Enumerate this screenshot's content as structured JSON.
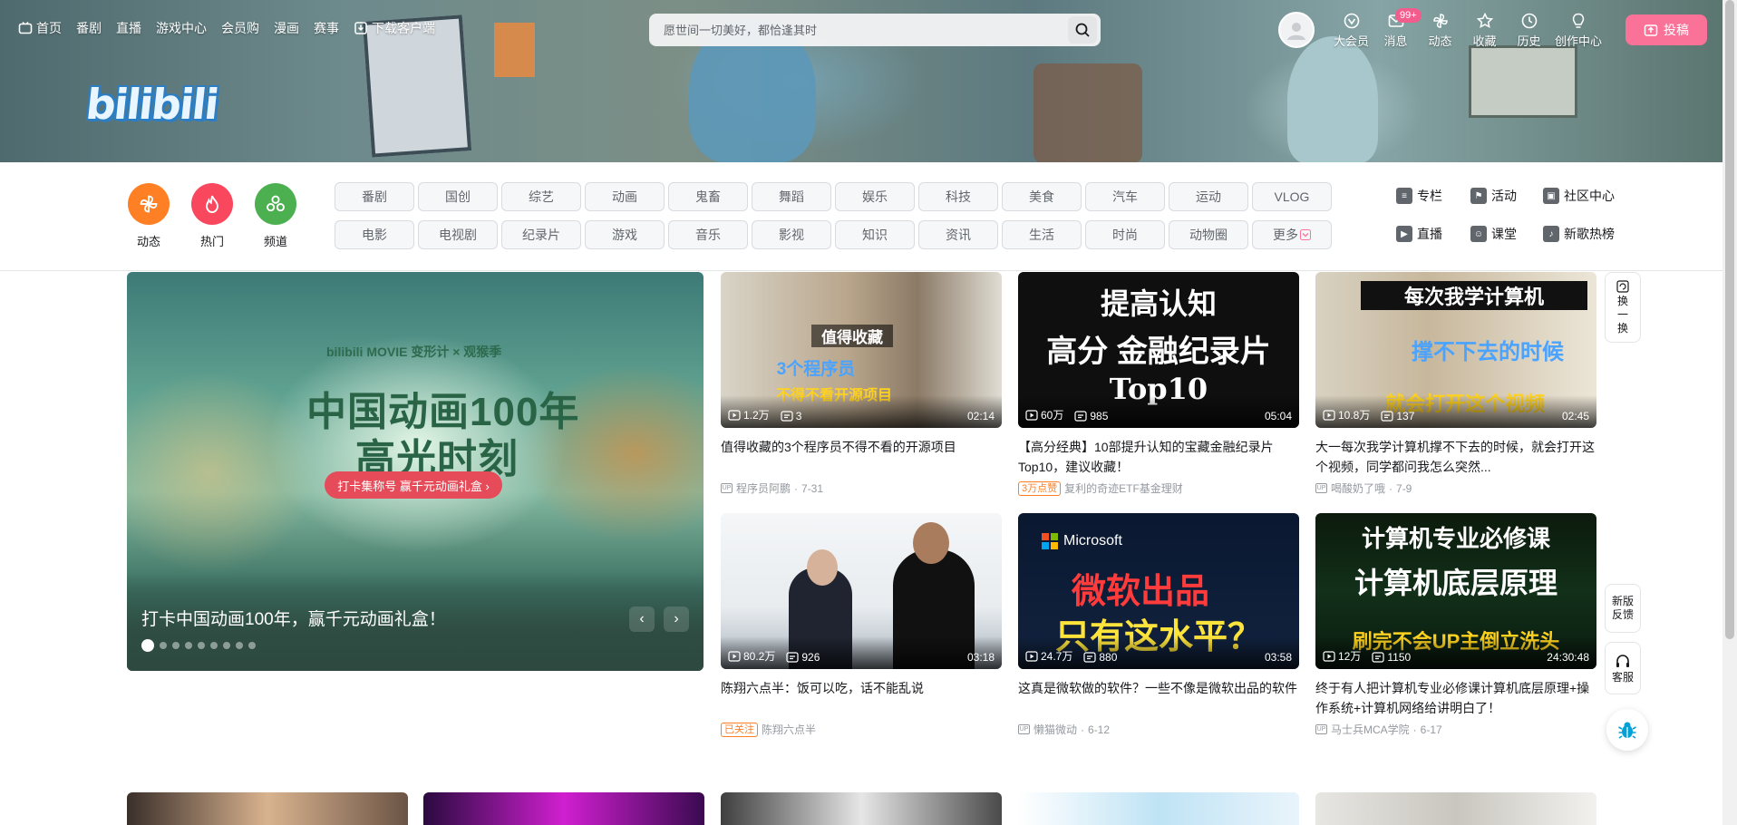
{
  "topnav": {
    "items": [
      {
        "label": "首页",
        "icon": "tv-icon"
      },
      {
        "label": "番剧"
      },
      {
        "label": "直播"
      },
      {
        "label": "游戏中心"
      },
      {
        "label": "会员购"
      },
      {
        "label": "漫画"
      },
      {
        "label": "赛事"
      },
      {
        "label": "下载客户端",
        "icon": "download-icon"
      }
    ]
  },
  "search": {
    "placeholder": "愿世间一切美好，都恰逢其时"
  },
  "logo": {
    "text": "bilibili"
  },
  "rightnav": {
    "items": [
      {
        "label": "大会员",
        "icon": "vip-icon"
      },
      {
        "label": "消息",
        "icon": "message-icon",
        "badge": "99+"
      },
      {
        "label": "动态",
        "icon": "dynamic-icon"
      },
      {
        "label": "收藏",
        "icon": "star-icon"
      },
      {
        "label": "历史",
        "icon": "clock-icon"
      },
      {
        "label": "创作中心",
        "icon": "bulb-icon"
      }
    ],
    "upload": "投稿"
  },
  "category": {
    "big": [
      {
        "label": "动态",
        "color": "#ff7f24"
      },
      {
        "label": "热门",
        "color": "#f9475d"
      },
      {
        "label": "频道",
        "color": "#4caf50"
      }
    ],
    "tags": [
      "番剧",
      "国创",
      "综艺",
      "动画",
      "鬼畜",
      "舞蹈",
      "娱乐",
      "科技",
      "美食",
      "汽车",
      "运动",
      "VLOG",
      "电影",
      "电视剧",
      "纪录片",
      "游戏",
      "音乐",
      "影视",
      "知识",
      "资讯",
      "生活",
      "时尚",
      "动物圈",
      "更多"
    ],
    "links": [
      "专栏",
      "活动",
      "社区中心",
      "直播",
      "课堂",
      "新歌热榜"
    ]
  },
  "carousel": {
    "sub": "bilibili MOVIE 变形计 × 观猴季",
    "title1": "中国动画100年",
    "title2": "高光时刻",
    "pill": "打卡集称号 赢千元动画礼盒 ›",
    "caption": "打卡中国动画100年，赢千元动画礼盒！",
    "dots": 9
  },
  "videos": [
    {
      "thumb_text": "值得收藏 3个程序员 不得不看开源项目",
      "views": "1.2万",
      "danmaku": "3",
      "duration": "02:14",
      "title": "值得收藏的3个程序员不得不看的开源项目",
      "up": "程序员阿鹏",
      "date": "7-31"
    },
    {
      "thumb_text": "提高认知 高分 金融纪录片 Top10",
      "views": "60万",
      "danmaku": "985",
      "duration": "05:04",
      "title": "【高分经典】10部提升认知的宝藏金融纪录片Top10，建议收藏！",
      "tag": "3万点赞",
      "up": "复利的奇迹ETF基金理财"
    },
    {
      "thumb_text": "每次我学计算机 撑不下去的时候 就会打开这个视频",
      "views": "10.8万",
      "danmaku": "137",
      "duration": "02:45",
      "title": "大一每次我学计算机撑不下去的时候，就会打开这个视频，同学都问我怎么突然...",
      "up": "喝酸奶了哦",
      "date": "7-9"
    },
    {
      "thumb_text": "",
      "views": "80.2万",
      "danmaku": "926",
      "duration": "03:18",
      "title": "陈翔六点半：饭可以吃，话不能乱说",
      "tag": "已关注",
      "up": "陈翔六点半"
    },
    {
      "thumb_text": "Microsoft 微软出品 只有这水平？",
      "views": "24.7万",
      "danmaku": "880",
      "duration": "03:58",
      "title": "这真是微软做的软件？一些不像是微软出品的软件",
      "up": "懒猫微动",
      "date": "6-12"
    },
    {
      "thumb_text": "计算机专业必修课 计算机底层原理 刷完不会UP主倒立洗头",
      "views": "12万",
      "danmaku": "1150",
      "duration": "24:30:48",
      "title": "终于有人把计算机专业必修课计算机底层原理+操作系统+计算机网络给讲明白了！",
      "up": "马士兵MCA学院",
      "date": "6-17"
    }
  ],
  "rail": {
    "refresh": "换一换",
    "feedback": "新版反馈",
    "service": "客服"
  },
  "colors": {
    "accent": "#fb7299",
    "badge": "#f25d8e"
  }
}
